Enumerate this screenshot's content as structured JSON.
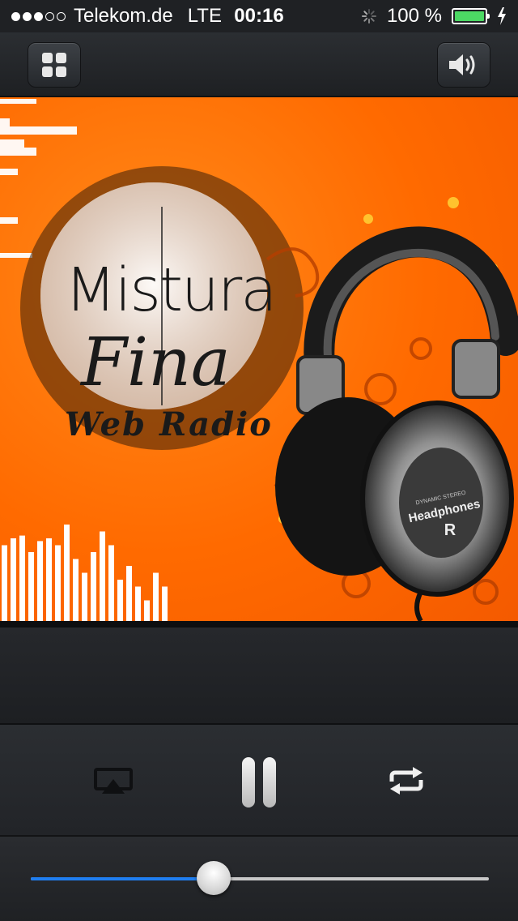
{
  "status_bar": {
    "signal_dots_filled": 3,
    "signal_dots_total": 5,
    "carrier": "Telekom.de",
    "network": "LTE",
    "time": "00:16",
    "battery_percent": "100 %",
    "battery_level": 1.0,
    "icons": [
      "activity-spinner-icon",
      "battery-icon",
      "charging-bolt-icon"
    ]
  },
  "toolbar": {
    "left_button_icon": "grid-icon",
    "right_button_icon": "speaker-icon"
  },
  "artwork": {
    "line1": "Mistura",
    "line2": "Fina",
    "line3": "Web Radio",
    "headphone_label": "Headphones",
    "headphone_side": "R",
    "headphone_small_text": "DYNAMIC STEREO"
  },
  "controls": {
    "airplay_icon": "airplay-icon",
    "pause_icon": "pause-icon",
    "repeat_icon": "repeat-icon"
  },
  "volume": {
    "level": 0.4
  },
  "colors": {
    "accent": "#1f7ef0",
    "artwork_orange": "#ff6a00",
    "battery_green": "#4cd964"
  }
}
